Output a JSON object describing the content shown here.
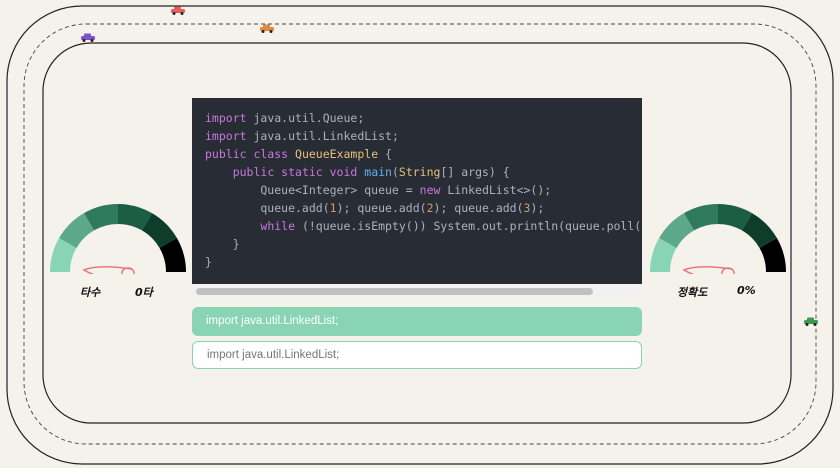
{
  "code_lines": [
    {
      "text": "import java.util.Queue;"
    },
    {
      "text": "import java.util.LinkedList;"
    },
    {
      "text": "public class QueueExample {"
    },
    {
      "text": "    public static void main(String[] args) {"
    },
    {
      "text": "        Queue<Integer> queue = new LinkedList<>();"
    },
    {
      "text": "        queue.add(1); queue.add(2); queue.add(3);"
    },
    {
      "text": "        while (!queue.isEmpty()) System.out.println(queue.poll());"
    },
    {
      "text": "    }"
    },
    {
      "text": "}"
    }
  ],
  "current_line": "import java.util.LinkedList;",
  "typing_input": {
    "value": "",
    "placeholder": "import java.util.LinkedList;"
  },
  "speed_gauge": {
    "label": "타수",
    "value": "0타",
    "level": 0
  },
  "accuracy_gauge": {
    "label": "정확도",
    "value": "0%",
    "level": 0
  },
  "gauge_colors": [
    "#88d4b5",
    "#5ba88a",
    "#2f7a5e",
    "#1b5e45",
    "#0f3d2c",
    "#000000"
  ],
  "cars": [
    {
      "icon": "red-car-icon",
      "color": "#e06060"
    },
    {
      "icon": "purple-car-icon",
      "color": "#7b55c7"
    },
    {
      "icon": "orange-car-icon",
      "color": "#e08a40"
    },
    {
      "icon": "green-car-icon",
      "color": "#3f9a4a"
    }
  ]
}
